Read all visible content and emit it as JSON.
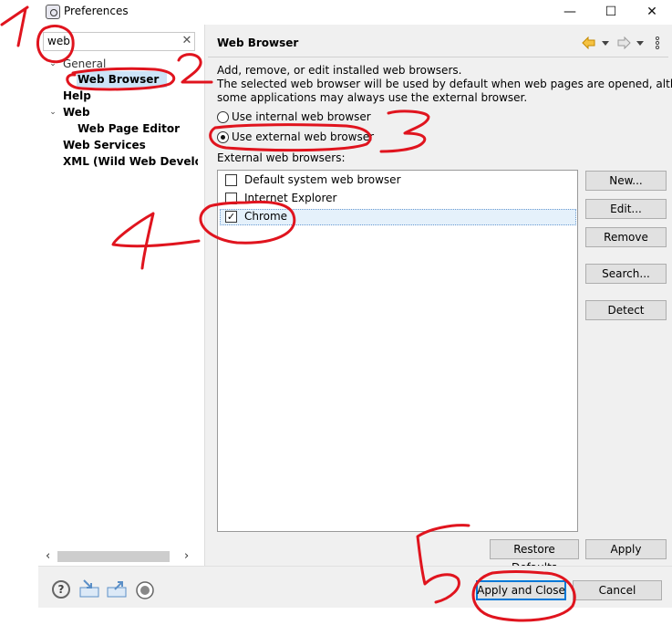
{
  "window": {
    "title": "Preferences",
    "minimize_glyph": "—",
    "maximize_glyph": "☐",
    "close_glyph": "✕"
  },
  "sidebar": {
    "search_value": "web",
    "search_clear": "✕",
    "tree": [
      {
        "label": "General",
        "expanded": true,
        "bold": false
      },
      {
        "label": "Web Browser",
        "selected": true,
        "bold": true
      },
      {
        "label": "Help",
        "bold": true
      },
      {
        "label": "Web",
        "expanded": true,
        "bold": true
      },
      {
        "label": "Web Page Editor",
        "bold": true
      },
      {
        "label": "Web Services",
        "bold": true
      },
      {
        "label": "XML (Wild Web Develope",
        "bold": true
      }
    ],
    "scroll_left": "‹",
    "scroll_right": "›"
  },
  "main": {
    "title": "Web Browser",
    "description_1": "Add, remove, or edit installed web browsers.",
    "description_2": "The selected web browser will be used by default when web pages are opened, although",
    "description_3": "some applications may always use the external browser.",
    "radio_internal": "Use internal web browser",
    "radio_external": "Use external web browser",
    "selected_option": "external",
    "list_label": "External web browsers:",
    "browsers": [
      {
        "name": "Default system web browser",
        "checked": false
      },
      {
        "name": "Internet Explorer",
        "checked": false
      },
      {
        "name": "Chrome",
        "checked": true
      }
    ],
    "buttons": {
      "new": "New...",
      "edit": "Edit...",
      "remove": "Remove",
      "search": "Search...",
      "detect": "Detect"
    },
    "restore_defaults": "Restore Defaults",
    "apply": "Apply"
  },
  "footer": {
    "apply_close": "Apply and Close",
    "cancel": "Cancel",
    "help_glyph": "?"
  },
  "annotations": {
    "numbers": [
      "1",
      "2",
      "3",
      "4",
      "5"
    ],
    "color": "#e0141e"
  },
  "colors": {
    "accent": "#0078d7",
    "selection": "#cce4f7",
    "nav_arrow": "#e8a200"
  }
}
